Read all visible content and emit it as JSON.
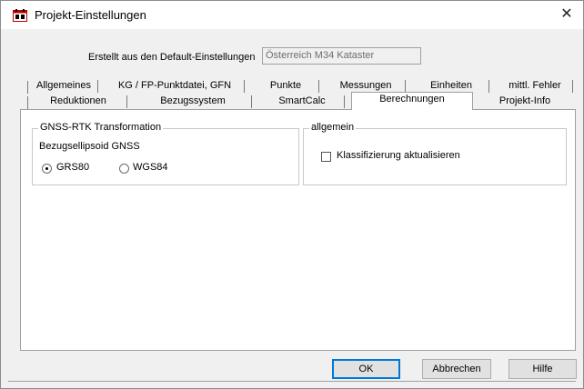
{
  "window": {
    "title": "Projekt-Einstellungen",
    "close_glyph": "✕"
  },
  "defaults": {
    "label": "Erstellt aus den Default-Einstellungen",
    "value": "Österreich M34 Kataster"
  },
  "tabs": {
    "row1": [
      "Allgemeines",
      "KG / FP-Punktdatei, GFN",
      "Punkte",
      "Messungen",
      "Einheiten",
      "mittl. Fehler"
    ],
    "row2": [
      "Reduktionen",
      "Bezugssystem",
      "SmartCalc",
      "Berechnungen",
      "Projekt-Info"
    ],
    "selected": "Berechnungen"
  },
  "gnss_group": {
    "title": "GNSS-RTK Transformation",
    "subtitle": "Bezugsellipsoid GNSS",
    "options": [
      {
        "label": "GRS80",
        "checked": true
      },
      {
        "label": "WGS84",
        "checked": false
      }
    ]
  },
  "general_group": {
    "title": "allgemein",
    "checkbox_label": "Klassifizierung aktualisieren",
    "checked": false
  },
  "buttons": {
    "ok": "OK",
    "cancel": "Abbrechen",
    "help": "Hilfe"
  }
}
